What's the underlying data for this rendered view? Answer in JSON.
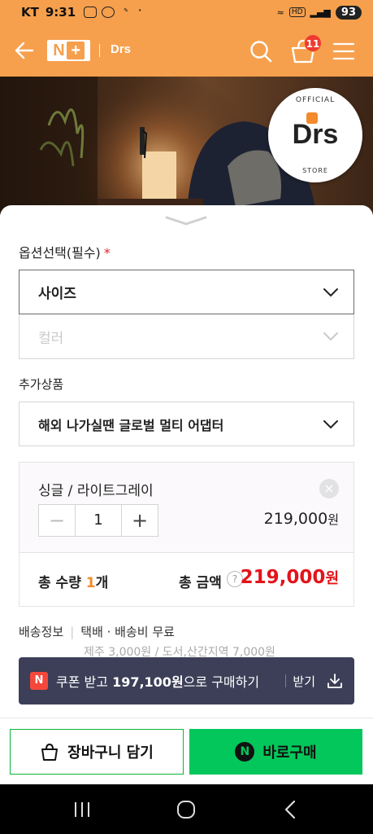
{
  "status_bar": {
    "carrier": "KT",
    "time": "9:31",
    "battery": "93"
  },
  "header": {
    "logo_text": "N+",
    "brand_text": "Drs",
    "cart_count": "11"
  },
  "badge": {
    "top_text": "OFFICIAL",
    "brand": "Drs",
    "bottom_text": "STORE"
  },
  "options": {
    "section_label": "옵션선택(필수)",
    "required_mark": "*",
    "size_label": "사이즈",
    "color_label": "컬러"
  },
  "addons": {
    "section_label": "추가상품",
    "addon_select": "해외 나가실땐 글로벌 멀티 어댑터"
  },
  "selected_item": {
    "name": "싱글 / 라이트그레이",
    "quantity": "1",
    "price": "219,000",
    "currency": "원"
  },
  "totals": {
    "qty_prefix": "총 수량 ",
    "qty_value": "1",
    "qty_suffix": "개",
    "amount_label": "총 금액",
    "help": "?",
    "amount": "219,000",
    "currency": "원"
  },
  "delivery": {
    "label": "배송정보",
    "info": "택배 · 배송비 무료",
    "extra": "제주 3,000원 / 도서,산간지역 7,000원"
  },
  "coupon": {
    "n_label": "N",
    "text_prefix": "쿠폰 받고 ",
    "amount": "197,100원",
    "text_suffix": "으로 구매하기",
    "receive_label": "받기"
  },
  "footer": {
    "cart_button": "장바구니 담기",
    "buy_n": "N",
    "buy_button": "바로구매"
  },
  "colors": {
    "header_orange": "#f6a04d",
    "price_red": "#e3141b",
    "naver_green": "#03c75a",
    "coupon_bg": "#3c3f57"
  }
}
